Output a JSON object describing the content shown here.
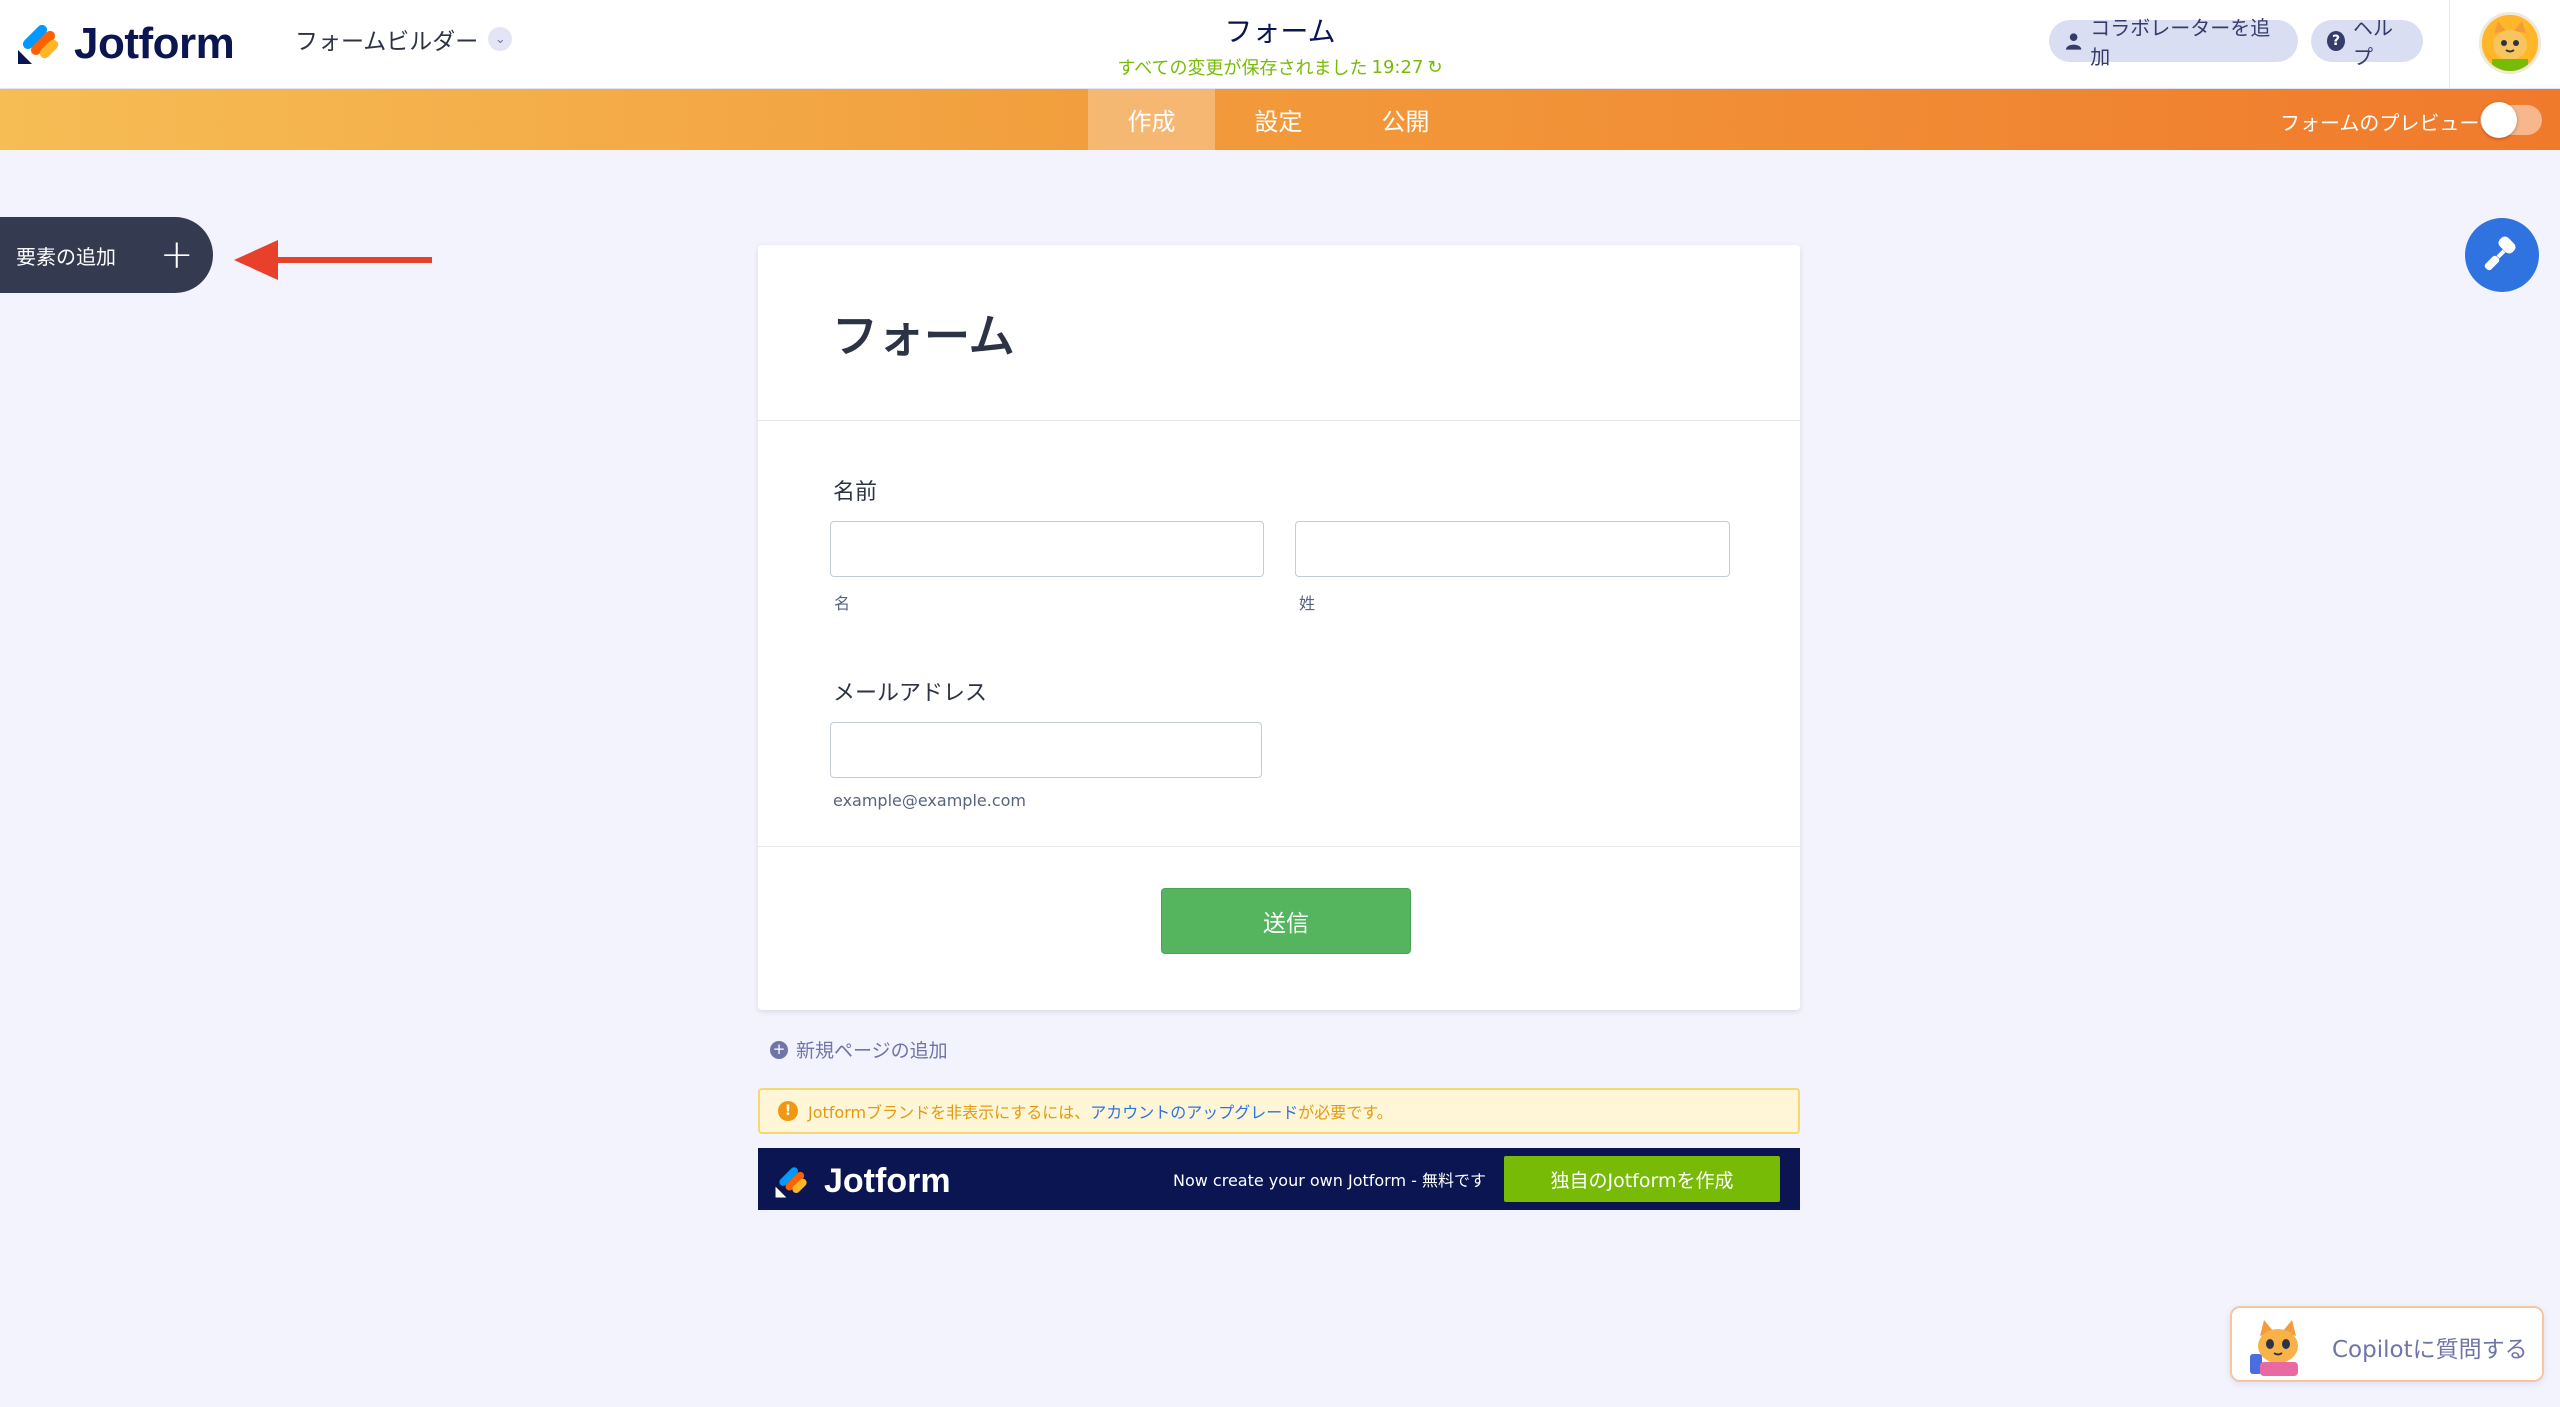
{
  "header": {
    "brand": "Jotform",
    "builder_menu": "フォームビルダー",
    "form_title": "フォーム",
    "save_status": "すべての変更が保存されました",
    "save_time": "19:27",
    "collab_label": "コラボレーターを追加",
    "help_label": "ヘルプ"
  },
  "navbar": {
    "tabs": [
      {
        "label": "作成",
        "active": true
      },
      {
        "label": "設定",
        "active": false
      },
      {
        "label": "公開",
        "active": false
      }
    ],
    "preview_label": "フォームのプレビュー",
    "preview_on": false
  },
  "sidebar": {
    "add_element_label": "要素の追加"
  },
  "form": {
    "title": "フォーム",
    "name_label": "名前",
    "first_sublabel": "名",
    "last_sublabel": "姓",
    "email_label": "メールアドレス",
    "email_sublabel": "example@example.com",
    "submit_label": "送信"
  },
  "add_page_label": "新規ページの追加",
  "notice": {
    "prefix": "Jotformブランドを非表示にするには、",
    "link": "アカウントのアップグレード",
    "suffix": "が必要です。"
  },
  "brand_footer": {
    "brand": "Jotform",
    "tagline": "Now create your own Jotform - 無料です",
    "cta": "独自のJotformを作成"
  },
  "copilot_label": "Copilotに質問する",
  "colors": {
    "accent_orange": "#f07a2c",
    "submit_green": "#55b55e",
    "brand_navy": "#0a1551",
    "design_blue": "#2f73e0"
  }
}
